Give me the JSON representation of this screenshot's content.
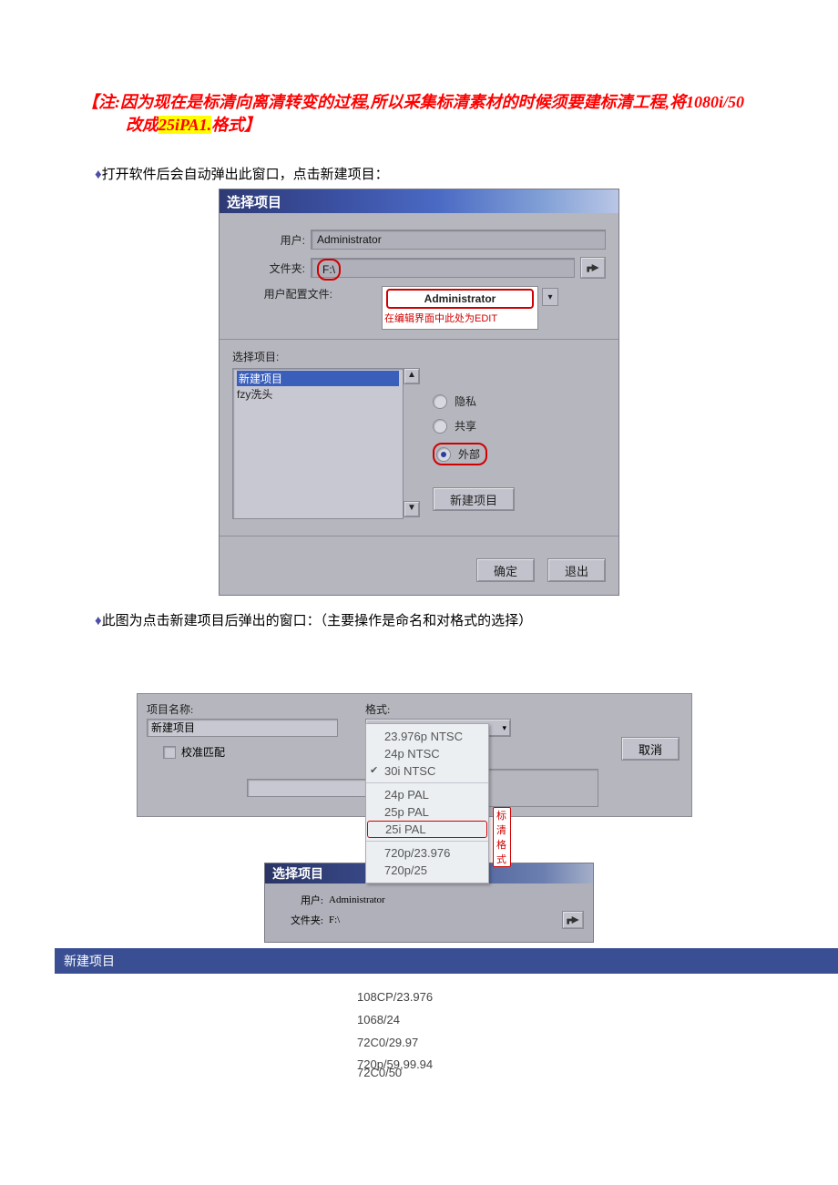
{
  "note": {
    "line1": "【注:因为现在是标清向离清转变的过程,所以采集标清素材的时候须要建标清工程,将1080i/50",
    "line2_pre": "改成",
    "line2_hl": "25iPA1.",
    "line2_post": "格式】"
  },
  "bullets": {
    "b1": "打开软件后会自动弹出此窗口，点击新建项目：",
    "b2": "此图为点击新建项目后弹出的窗口：（主要操作是命名和对格式的选择）"
  },
  "dlg1": {
    "title": "选择项目",
    "user_label": "用户:",
    "user_value": "Administrator",
    "folder_label": "文件夹:",
    "folder_value": "F:\\",
    "config_label": "用户配置文件:",
    "admin_box": "Administrator",
    "admin_sub": "在编辑界面中此处为EDIT",
    "select_label": "选择项目:",
    "list_selected": "新建项目",
    "list_item1": "fzy洗头",
    "radio_private": "隐私",
    "radio_share": "共享",
    "radio_external": "外部",
    "new_btn": "新建项目",
    "ok": "确定",
    "exit": "退出"
  },
  "dlg2": {
    "name_label": "项目名称:",
    "name_value": "新建项目",
    "checkbox": "校准匹配",
    "format_label": "格式:",
    "combo_value": "30i NTSC",
    "menu1": "23.976p NTSC",
    "menu2": "24p NTSC",
    "menu3": "30i NTSC",
    "menu4": "24p PAL",
    "menu5": "25p PAL",
    "menu6": "25i PAL",
    "menu7": "720p/23.976",
    "menu8": "720p/25",
    "red_tag": "标清格式",
    "cancel": "取消"
  },
  "dlg3": {
    "title": "选择项目",
    "user_label": "用户:",
    "user_value": "Administrator",
    "folder_label": "文件夹:",
    "folder_value": "F:\\"
  },
  "bluebar": "新建项目",
  "formats": {
    "f1": "108CP/23.976",
    "f2": "1068/24",
    "f3": "72C0/29.97",
    "f4a": "720p/59,99.94",
    "f4b": "72C0/50"
  }
}
